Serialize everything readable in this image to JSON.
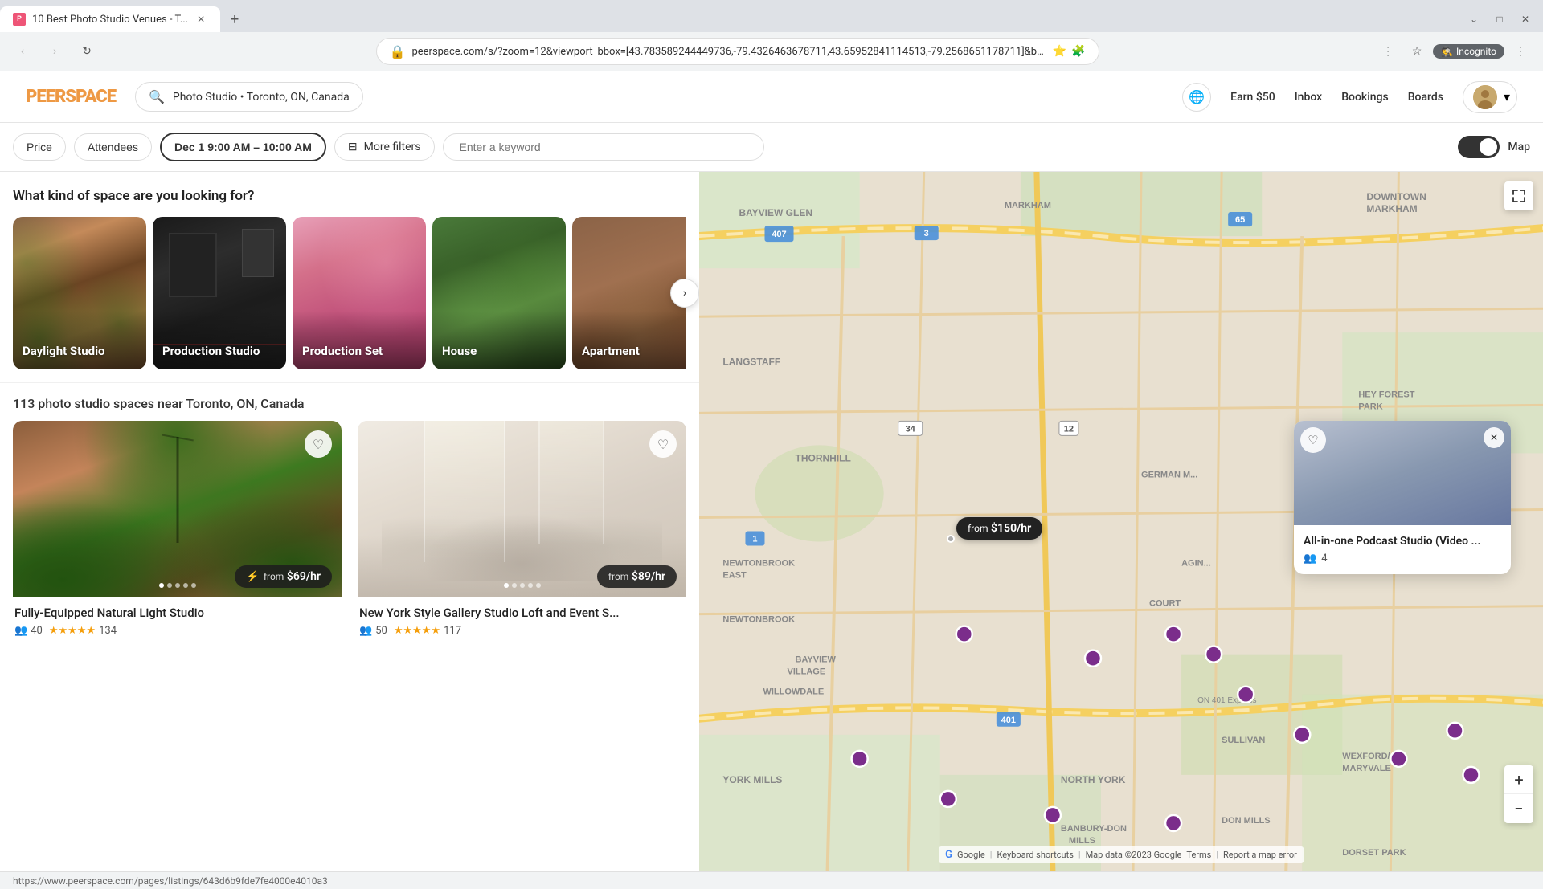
{
  "browser": {
    "tab_title": "10 Best Photo Studio Venues - T...",
    "favicon_text": "P",
    "url": "peerspace.com/s/?zoom=12&viewport_bbox=[43.783589244449736,-79.4326463678711,43.65952841114513,-79.2568651178711]&bbox_of_in...",
    "incognito_label": "Incognito"
  },
  "header": {
    "logo": "PEERSPACE",
    "search_text": "Photo Studio • Toronto, ON, Canada",
    "nav_items": [
      "Earn $50",
      "Inbox",
      "Bookings",
      "Boards"
    ]
  },
  "filters": {
    "price_label": "Price",
    "attendees_label": "Attendees",
    "datetime_label": "Dec 1 9:00 AM – 10:00 AM",
    "more_filters_label": "More filters",
    "keyword_placeholder": "Enter a keyword",
    "map_label": "Map"
  },
  "space_types": {
    "question": "What kind of space are you looking for?",
    "cards": [
      {
        "label": "Daylight Studio",
        "color_hint": "warm_studio"
      },
      {
        "label": "Production Studio",
        "color_hint": "dark_studio"
      },
      {
        "label": "Production Set",
        "color_hint": "pink_studio"
      },
      {
        "label": "House",
        "color_hint": "green_space"
      },
      {
        "label": "Apartment",
        "color_hint": "brown_space"
      }
    ]
  },
  "results": {
    "count_text": "113 photo studio spaces near Toronto, ON, Canada"
  },
  "listings": [
    {
      "id": "listing-1",
      "title": "Fully-Equipped Natural Light Studio",
      "price_from": "from",
      "price": "$69/hr",
      "has_flash": true,
      "attendees": 40,
      "rating_stars": "★★★★★",
      "review_count": 134,
      "img_type": "studio1"
    },
    {
      "id": "listing-2",
      "title": "New York Style Gallery Studio Loft and Event S...",
      "price_from": "from",
      "price": "$89/hr",
      "has_flash": false,
      "attendees": 50,
      "rating_stars": "★★★★★",
      "review_count": 117,
      "img_type": "studio2"
    }
  ],
  "map_popup": {
    "title": "All-in-one Podcast Studio (Video ...",
    "attendees": 4,
    "attendees_icon": "👥"
  },
  "map": {
    "price_pin": {
      "from_text": "from",
      "price": "$150/hr"
    },
    "zoom_in": "+",
    "zoom_out": "−",
    "attribution": "Google"
  },
  "icons": {
    "search": "🔍",
    "globe": "🌐",
    "heart": "♡",
    "heart_filled": "♥",
    "close": "✕",
    "chevron_right": "›",
    "flash": "⚡",
    "user": "👤",
    "attendees": "👥",
    "fullscreen": "⛶",
    "filters_icon": "⊟"
  }
}
